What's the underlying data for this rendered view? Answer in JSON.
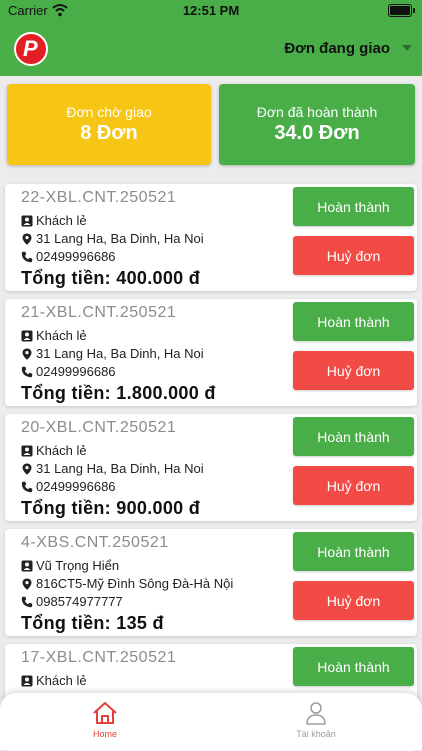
{
  "status_bar": {
    "carrier": "Carrier",
    "time": "12:51 PM"
  },
  "header": {
    "logo_letter": "P",
    "filter_label": "Đơn đang giao"
  },
  "summary": {
    "pending": {
      "label": "Đơn chờ giao",
      "value": "8 Đơn"
    },
    "completed": {
      "label": "Đơn đã hoàn thành",
      "value": "34.0 Đơn"
    }
  },
  "orders": [
    {
      "code": "22-XBL.CNT.250521",
      "customer": "Khách lẻ",
      "address": "31 Lang Ha, Ba Dinh, Ha Noi",
      "phone": "02499996686",
      "total": "Tổng tiền: 400.000 đ",
      "complete_label": "Hoàn thành",
      "cancel_label": "Huỷ đơn"
    },
    {
      "code": "21-XBL.CNT.250521",
      "customer": "Khách lẻ",
      "address": "31 Lang Ha, Ba Dinh, Ha Noi",
      "phone": "02499996686",
      "total": "Tổng tiền: 1.800.000 đ",
      "complete_label": "Hoàn thành",
      "cancel_label": "Huỷ đơn"
    },
    {
      "code": "20-XBL.CNT.250521",
      "customer": "Khách lẻ",
      "address": "31 Lang Ha, Ba Dinh, Ha Noi",
      "phone": "02499996686",
      "total": "Tổng tiền: 900.000 đ",
      "complete_label": "Hoàn thành",
      "cancel_label": "Huỷ đơn"
    },
    {
      "code": "4-XBS.CNT.250521",
      "customer": "Vũ Trọng Hiển",
      "address": "816CT5-Mỹ Đình Sông Đà-Hà Nội",
      "phone": "098574977777",
      "total": "Tổng tiền: 135 đ",
      "complete_label": "Hoàn thành",
      "cancel_label": "Huỷ đơn"
    },
    {
      "code": "17-XBL.CNT.250521",
      "customer": "Khách lẻ",
      "complete_label": "Hoàn thành"
    }
  ],
  "tabbar": {
    "home_label": "Home",
    "account_label": "Tài khoản"
  },
  "colors": {
    "primary": "#49ad48",
    "pending": "#f7c513",
    "danger": "#f24b46",
    "active_tab": "#e2403a"
  }
}
